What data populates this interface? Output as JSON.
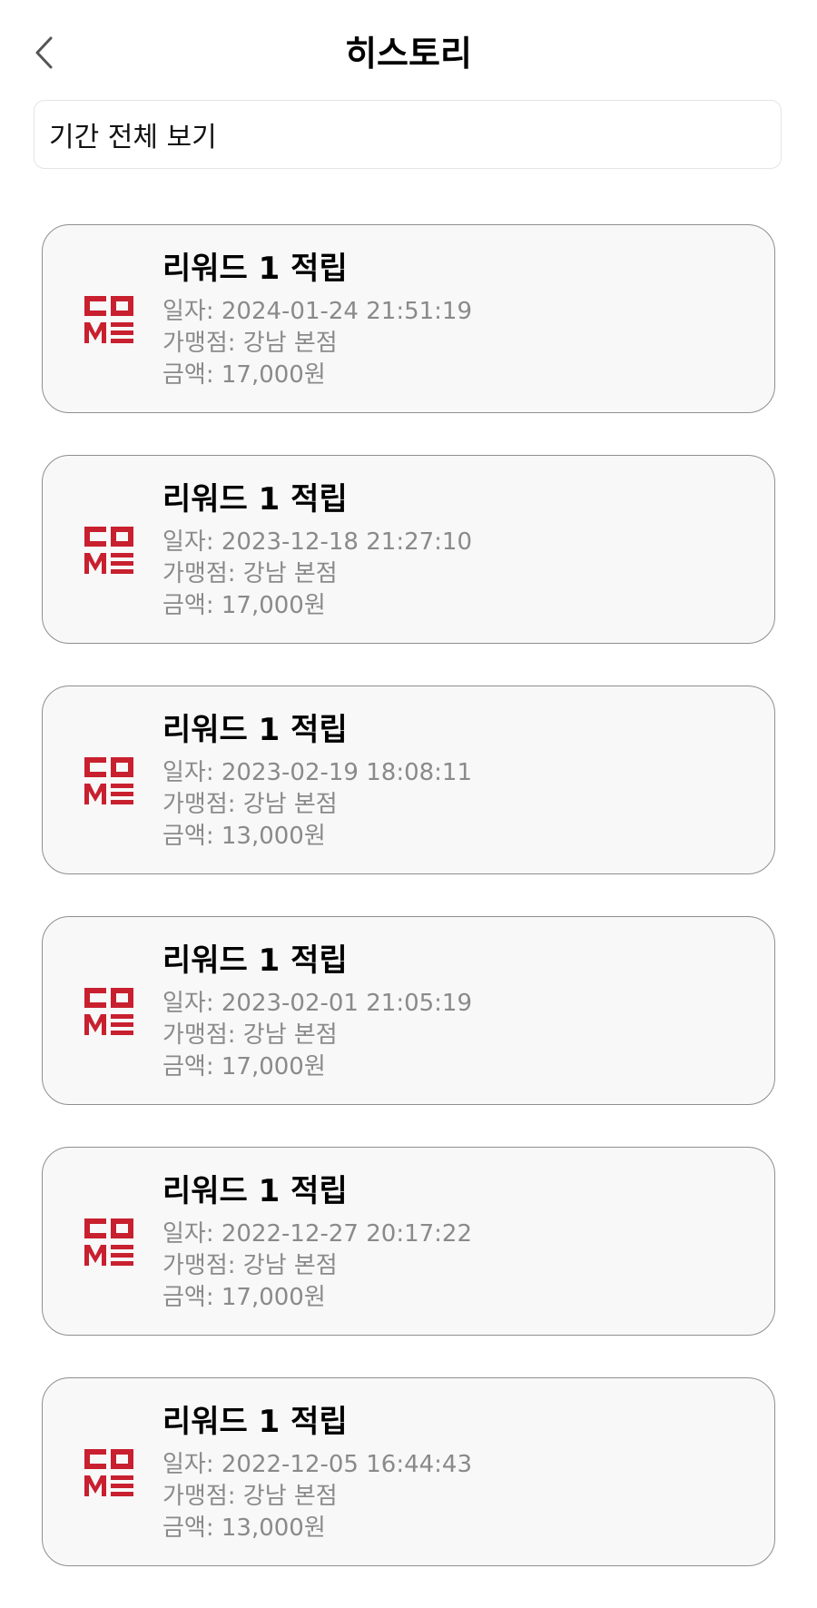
{
  "header": {
    "title": "히스토리",
    "back_icon": "chevron-left-icon"
  },
  "filter": {
    "label": "기간 전체 보기"
  },
  "brand": {
    "logo_text": "COME",
    "logo_color": "#c8202f"
  },
  "history": [
    {
      "title": "리워드 1 적립",
      "date": "일자: 2024-01-24 21:51:19",
      "store": "가맹점: 강남 본점",
      "amount": "금액: 17,000원"
    },
    {
      "title": "리워드 1 적립",
      "date": "일자: 2023-12-18 21:27:10",
      "store": "가맹점: 강남 본점",
      "amount": "금액: 17,000원"
    },
    {
      "title": "리워드 1 적립",
      "date": "일자: 2023-02-19 18:08:11",
      "store": "가맹점: 강남 본점",
      "amount": "금액: 13,000원"
    },
    {
      "title": "리워드 1 적립",
      "date": "일자: 2023-02-01 21:05:19",
      "store": "가맹점: 강남 본점",
      "amount": "금액: 17,000원"
    },
    {
      "title": "리워드 1 적립",
      "date": "일자: 2022-12-27 20:17:22",
      "store": "가맹점: 강남 본점",
      "amount": "금액: 17,000원"
    },
    {
      "title": "리워드 1 적립",
      "date": "일자: 2022-12-05 16:44:43",
      "store": "가맹점: 강남 본점",
      "amount": "금액: 13,000원"
    }
  ]
}
